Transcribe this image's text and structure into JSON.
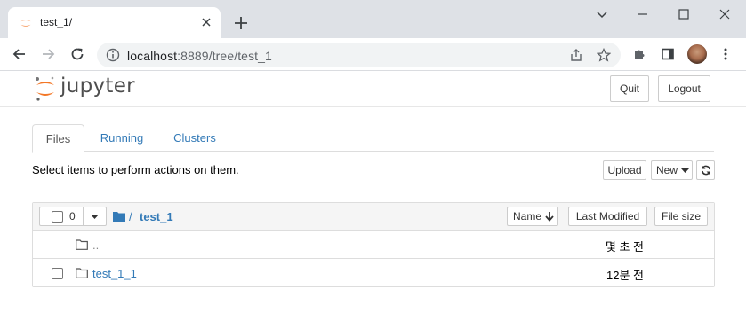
{
  "browser": {
    "tab_title": "test_1/",
    "url_host": "localhost",
    "url_rest": ":8889/tree/test_1"
  },
  "jupyter": {
    "logo_text": "jupyter",
    "quit_label": "Quit",
    "logout_label": "Logout",
    "tabs": [
      {
        "label": "Files"
      },
      {
        "label": "Running"
      },
      {
        "label": "Clusters"
      }
    ],
    "hint": "Select items to perform actions on them.",
    "upload_label": "Upload",
    "new_label": "New",
    "selected_count": "0",
    "breadcrumb_sep": "/",
    "breadcrumb_dir": "test_1",
    "sort_name_label": "Name",
    "last_modified_label": "Last Modified",
    "file_size_label": "File size",
    "items": [
      {
        "name": "..",
        "time": "몇 초 전"
      },
      {
        "name": "test_1_1",
        "time": "12분 전"
      }
    ]
  },
  "colors": {
    "link": "#337ab7",
    "jupyter_orange": "#F37726",
    "chrome_bg": "#dee1e6"
  }
}
